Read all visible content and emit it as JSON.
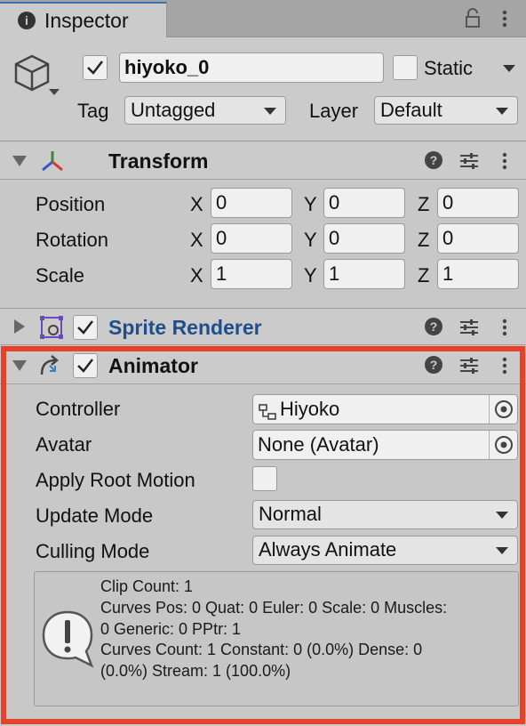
{
  "window": {
    "tab_label": "Inspector"
  },
  "gameobject": {
    "name": "hiyoko_0",
    "static_label": "Static",
    "tag_label": "Tag",
    "tag_value": "Untagged",
    "layer_label": "Layer",
    "layer_value": "Default"
  },
  "transform": {
    "title": "Transform",
    "rows": [
      {
        "label": "Position",
        "x": "0",
        "y": "0",
        "z": "0"
      },
      {
        "label": "Rotation",
        "x": "0",
        "y": "0",
        "z": "0"
      },
      {
        "label": "Scale",
        "x": "1",
        "y": "1",
        "z": "1"
      }
    ],
    "axis_x": "X",
    "axis_y": "Y",
    "axis_z": "Z"
  },
  "sprite_renderer": {
    "title": "Sprite Renderer",
    "title_color": "#1f4e8c"
  },
  "animator": {
    "title": "Animator",
    "controller_label": "Controller",
    "controller_value": "Hiyoko",
    "avatar_label": "Avatar",
    "avatar_value": "None (Avatar)",
    "apply_root_motion_label": "Apply Root Motion",
    "apply_root_motion_checked": false,
    "update_mode_label": "Update Mode",
    "update_mode_value": "Normal",
    "culling_mode_label": "Culling Mode",
    "culling_mode_value": "Always Animate",
    "info_lines": [
      "Clip Count: 1",
      "Curves Pos: 0 Quat: 0 Euler: 0 Scale: 0 Muscles:",
      "0 Generic: 0 PPtr: 1",
      "Curves Count: 1 Constant: 0 (0.0%) Dense: 0",
      "(0.0%) Stream: 1 (100.0%)"
    ]
  },
  "highlight_color": "#e8412b",
  "icons": {
    "tab": "info-icon",
    "lock": "lock-icon",
    "menu": "kebab-menu-icon",
    "gameobject": "cube-icon",
    "help": "help-icon",
    "presets": "sliders-icon",
    "transform": "transform-axes-icon",
    "sprite": "sprite-renderer-icon",
    "animator": "animator-icon",
    "object_picker": "target-picker-icon",
    "warning": "exclamation-bubble-icon",
    "controller": "animator-controller-icon"
  }
}
